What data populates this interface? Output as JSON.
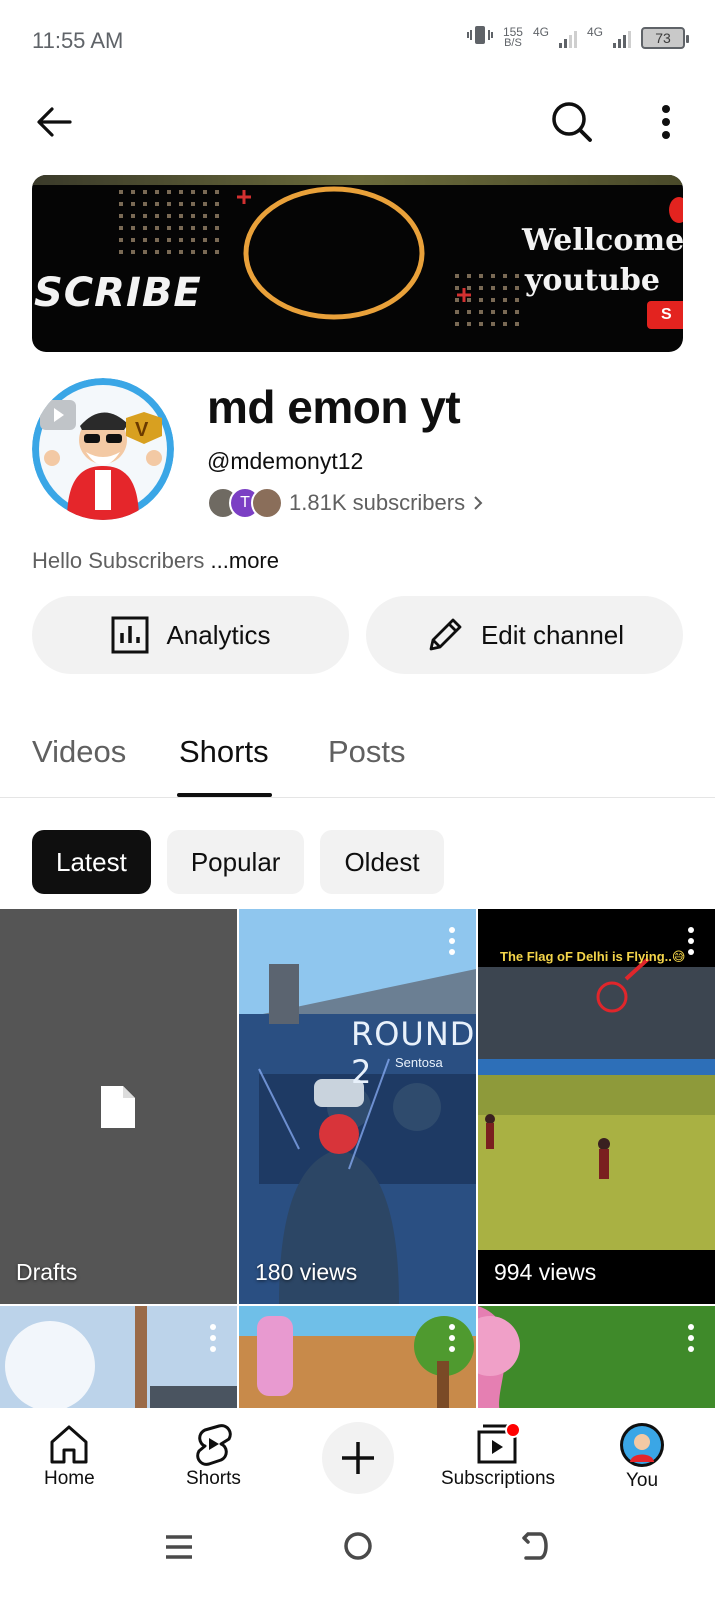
{
  "status_bar": {
    "time": "11:55 AM",
    "speed_value": "155",
    "speed_unit": "B/S",
    "network1": "4G",
    "network2": "4G",
    "battery": "73"
  },
  "banner": {
    "left_text": "SCRIBE",
    "right_line1": "Wellcome",
    "right_line2": "youtube",
    "red_label": "S"
  },
  "channel": {
    "name": "md emon yt",
    "handle": "@mdemonyt12",
    "subscribers": "1.81K subscribers",
    "mini_avatar_letter": "T",
    "description": "Hello Subscribers",
    "more_label": "...more"
  },
  "actions": {
    "analytics_label": "Analytics",
    "edit_label": "Edit channel"
  },
  "tabs": [
    {
      "label": "Videos"
    },
    {
      "label": "Shorts"
    },
    {
      "label": "Posts"
    }
  ],
  "chips": [
    {
      "label": "Latest"
    },
    {
      "label": "Popular"
    },
    {
      "label": "Oldest"
    }
  ],
  "grid": {
    "drafts_label": "Drafts",
    "short1_views": "180 views",
    "short1_overlay": "ROUND 2",
    "short1_overlay_sub": "Sentosa",
    "short2_views": "994 views",
    "short2_caption": "The Flag oF Delhi is Flying..😅"
  },
  "bottom_nav": {
    "home": "Home",
    "shorts": "Shorts",
    "subscriptions": "Subscriptions",
    "you": "You"
  },
  "colors": {
    "accent_red": "#ff0000",
    "chip_active": "#0f0f0f",
    "chip_bg": "#f2f2f2",
    "drafts_bg": "#555555"
  },
  "icons": [
    "back-arrow-icon",
    "search-icon",
    "more-vert-icon",
    "analytics-icon",
    "pencil-icon",
    "chevron-right-icon",
    "document-icon",
    "home-icon",
    "shorts-icon",
    "plus-icon",
    "subscriptions-icon",
    "recents-icon",
    "home-circle-icon",
    "back-gesture-icon"
  ]
}
